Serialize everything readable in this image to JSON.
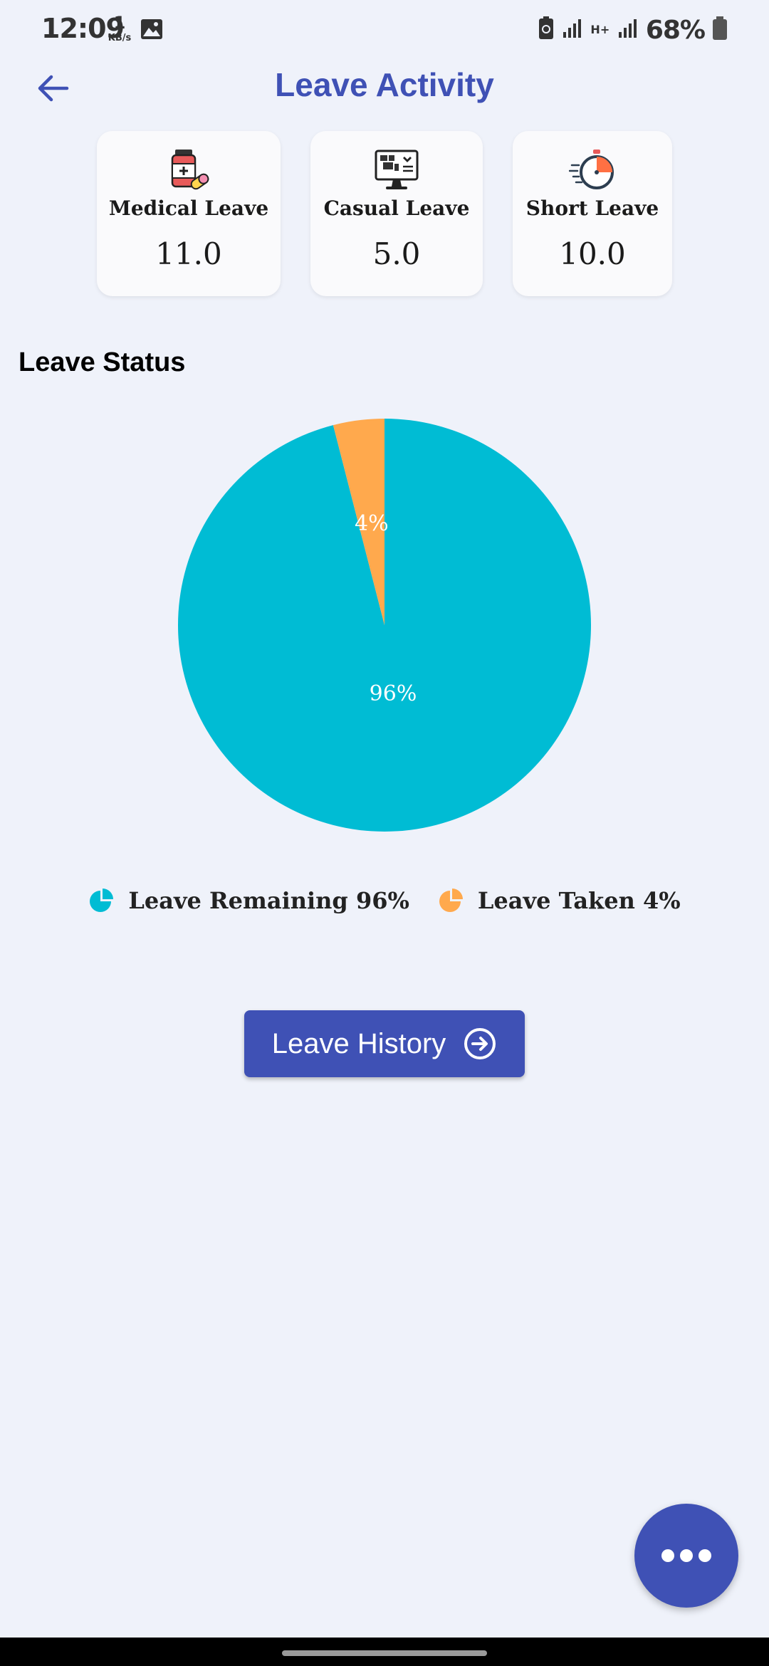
{
  "status_bar": {
    "time": "12:09",
    "net_speed_value": "1",
    "net_speed_unit": "KB/s",
    "network_type": "H+",
    "battery_percent": "68%"
  },
  "header": {
    "title": "Leave Activity"
  },
  "cards": [
    {
      "label": "Medical Leave",
      "value": "11.0",
      "icon": "medicine-icon"
    },
    {
      "label": "Casual Leave",
      "value": "5.0",
      "icon": "computer-icon"
    },
    {
      "label": "Short Leave",
      "value": "10.0",
      "icon": "stopwatch-icon"
    }
  ],
  "section": {
    "title": "Leave Status"
  },
  "chart_data": {
    "type": "pie",
    "slices": [
      {
        "label": "Leave Remaining",
        "value": 96,
        "color": "#00bcd4",
        "data_label": "96%"
      },
      {
        "label": "Leave Taken",
        "value": 4,
        "color": "#ffa94d",
        "data_label": "4%"
      }
    ]
  },
  "legend": [
    {
      "text": "Leave Remaining 96%",
      "color": "#00bcd4"
    },
    {
      "text": "Leave Taken 4%",
      "color": "#ffa94d"
    }
  ],
  "actions": {
    "history_label": "Leave History"
  },
  "colors": {
    "primary": "#3f51b5",
    "background": "#eff2fa"
  }
}
